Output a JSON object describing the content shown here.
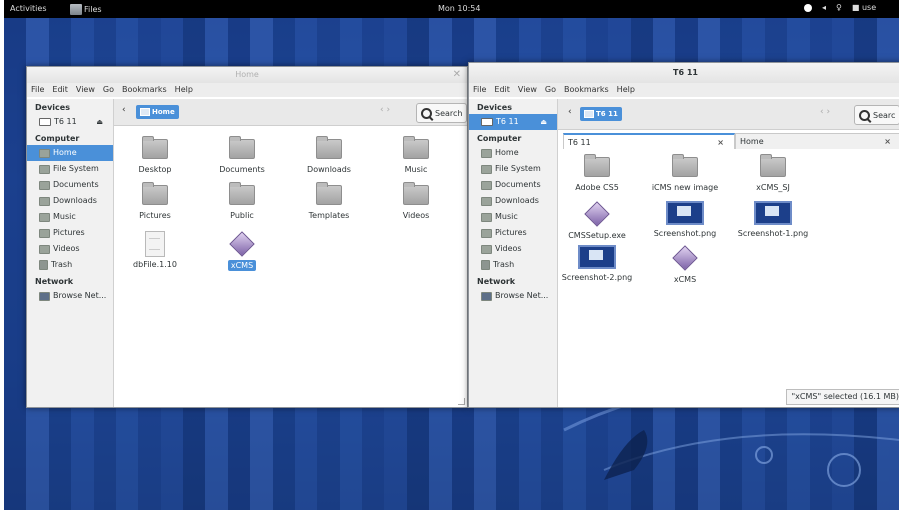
{
  "topbar": {
    "activities": "Activities",
    "app_name": "Files",
    "clock": "Mon 10:54",
    "user_text": "use"
  },
  "window_home": {
    "title": "Home",
    "menu": [
      "File",
      "Edit",
      "View",
      "Go",
      "Bookmarks",
      "Help"
    ],
    "sidebar": {
      "devices_header": "Devices",
      "device": "T6 11",
      "computer_header": "Computer",
      "computer_items": [
        {
          "label": "Home",
          "icon": "home-folder-icon"
        },
        {
          "label": "File System",
          "icon": "drive-icon"
        },
        {
          "label": "Documents",
          "icon": "folder-icon"
        },
        {
          "label": "Downloads",
          "icon": "folder-icon"
        },
        {
          "label": "Music",
          "icon": "folder-icon"
        },
        {
          "label": "Pictures",
          "icon": "folder-icon"
        },
        {
          "label": "Videos",
          "icon": "folder-icon"
        },
        {
          "label": "Trash",
          "icon": "trash-icon"
        }
      ],
      "network_header": "Network",
      "network_item": "Browse Net..."
    },
    "location": "Home",
    "search_label": "Search",
    "files": [
      {
        "name": "Desktop",
        "type": "folder"
      },
      {
        "name": "Documents",
        "type": "folder"
      },
      {
        "name": "Downloads",
        "type": "folder"
      },
      {
        "name": "Music",
        "type": "folder"
      },
      {
        "name": "Pictures",
        "type": "folder"
      },
      {
        "name": "Public",
        "type": "folder"
      },
      {
        "name": "Templates",
        "type": "folder"
      },
      {
        "name": "Videos",
        "type": "folder"
      },
      {
        "name": "dbFile.1.10",
        "type": "document"
      },
      {
        "name": "xCMS",
        "type": "diamond"
      }
    ]
  },
  "window_t6": {
    "title": "T6 11",
    "menu": [
      "File",
      "Edit",
      "View",
      "Go",
      "Bookmarks",
      "Help"
    ],
    "sidebar": {
      "devices_header": "Devices",
      "device": "T6 11",
      "computer_header": "Computer",
      "computer_items": [
        {
          "label": "Home"
        },
        {
          "label": "File System"
        },
        {
          "label": "Documents"
        },
        {
          "label": "Downloads"
        },
        {
          "label": "Music"
        },
        {
          "label": "Pictures"
        },
        {
          "label": "Videos"
        },
        {
          "label": "Trash"
        }
      ],
      "network_header": "Network",
      "network_item": "Browse Net..."
    },
    "location": "T6 11",
    "search_label": "Searc",
    "tabs": [
      {
        "label": "T6 11",
        "close": "×"
      },
      {
        "label": "Home",
        "close": "×"
      }
    ],
    "files": [
      {
        "name": "Adobe CS5",
        "type": "folder"
      },
      {
        "name": "iCMS new image",
        "type": "folder"
      },
      {
        "name": "xCMS_SJ",
        "type": "folder"
      },
      {
        "name": "CMSSetup.exe",
        "type": "diamond"
      },
      {
        "name": "Screenshot.png",
        "type": "screenshot"
      },
      {
        "name": "Screenshot-1.png",
        "type": "screenshot"
      },
      {
        "name": "Screenshot-2.png",
        "type": "screenshot"
      },
      {
        "name": "xCMS",
        "type": "diamond"
      }
    ],
    "status": "\"xCMS\" selected (16.1 MB)"
  },
  "colors": {
    "selection": "#4a90d9",
    "desktop": "#21489a",
    "topbar": "#000000"
  }
}
